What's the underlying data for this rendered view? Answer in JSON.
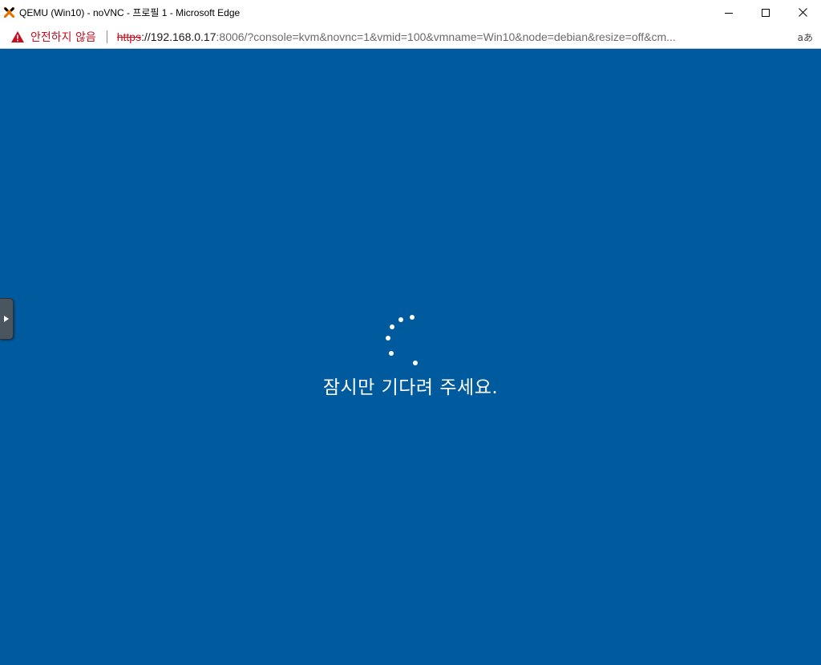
{
  "window": {
    "title": "QEMU (Win10) - noVNC - 프로필 1 - Microsoft Edge",
    "controls": [
      "minimize",
      "maximize",
      "close"
    ]
  },
  "address_bar": {
    "security_label": "안전하지 않음",
    "url_scheme": "https",
    "url_host": "://192.168.0.17",
    "url_rest": ":8006/?console=kvm&novnc=1&vmid=100&vmname=Win10&node=debian&resize=off&cm...",
    "read_aloud_label": "aあ"
  },
  "vm_screen": {
    "message": "잠시만 기다려 주세요.",
    "background_color": "#005a9e"
  },
  "colors": {
    "warning": "#c50f1f",
    "accent": "#005a9e"
  }
}
